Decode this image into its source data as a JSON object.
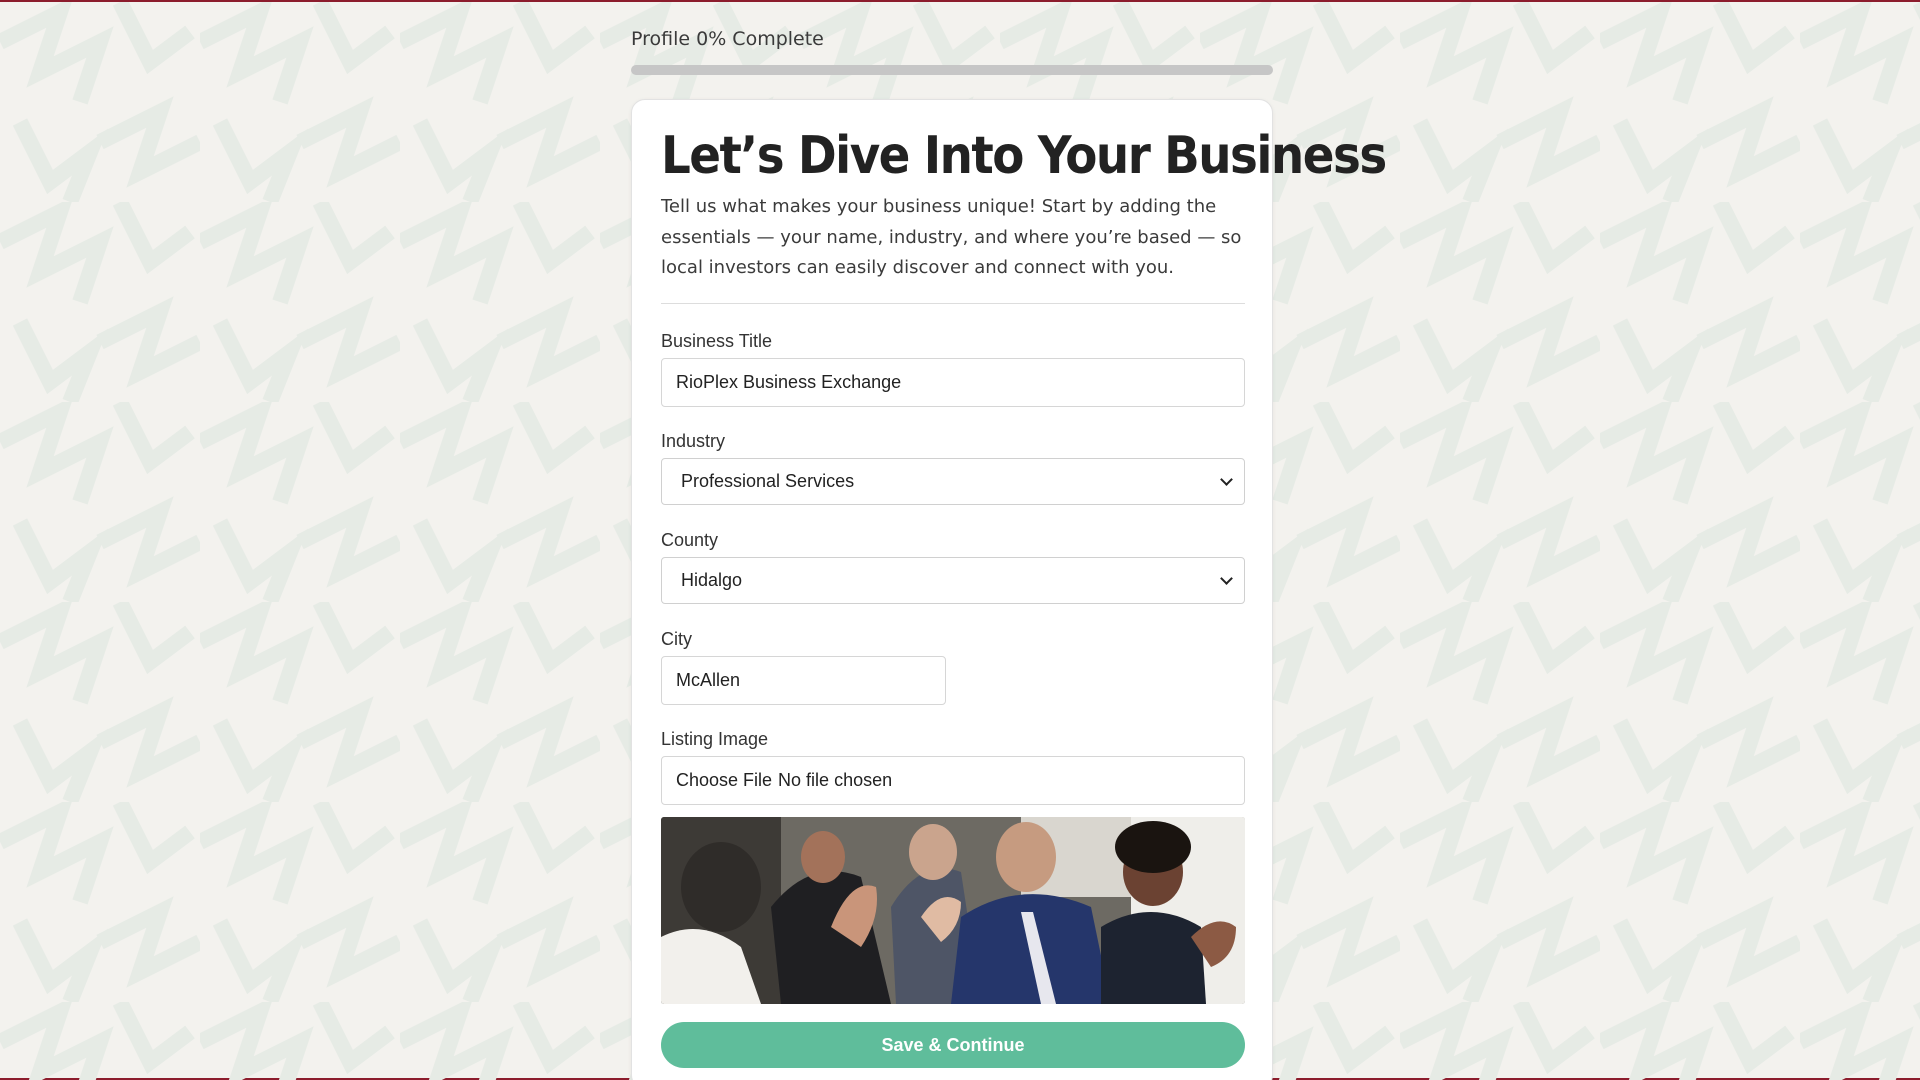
{
  "progress": {
    "label": "Profile 0% Complete",
    "fraction": 0
  },
  "card": {
    "title": "Let’s Dive Into Your Business",
    "intro": "Tell us what makes your business unique! Start by adding the essentials — your name, industry, and where you’re based — so local investors can easily discover and connect with you."
  },
  "form": {
    "business_title": {
      "label": "Business Title",
      "value": "RioPlex Business Exchange"
    },
    "industry": {
      "label": "Industry",
      "selected": "Professional Services"
    },
    "county": {
      "label": "County",
      "selected": "Hidalgo"
    },
    "city": {
      "label": "City",
      "value": "McAllen"
    },
    "listing_image": {
      "label": "Listing Image",
      "button": "Choose File",
      "status": "No file chosen"
    },
    "save_label": "Save & Continue"
  },
  "colors": {
    "accent": "#5fbd9b",
    "border_accent": "#8c1c2c",
    "background": "#f3f2ee"
  }
}
